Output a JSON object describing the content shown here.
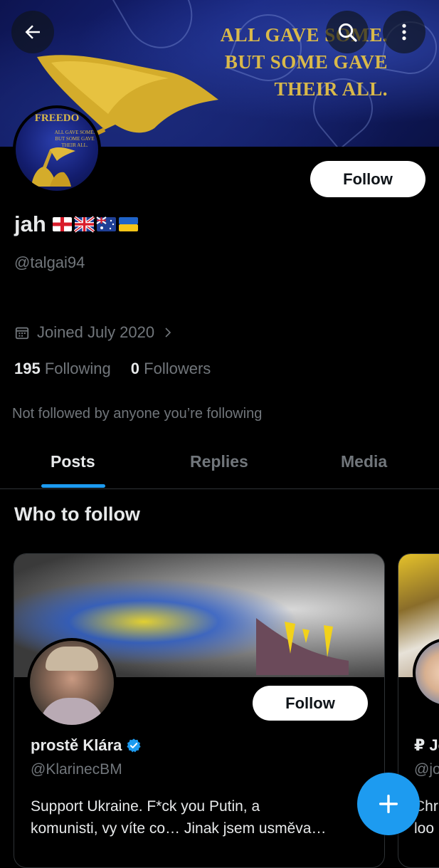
{
  "banner": {
    "text_lines": [
      "ALL GAVE SOME.",
      "BUT SOME GAVE",
      "THEIR ALL."
    ],
    "avatar_text": [
      "FREEDO",
      "ALL GAVE SOME.",
      "BUT SOME GAVE",
      "THEIR ALL."
    ]
  },
  "header": {
    "back_icon": "arrow-left-icon",
    "search_icon": "search-icon",
    "more_icon": "more-vertical-icon"
  },
  "profile": {
    "follow_label": "Follow",
    "display_name": "jah🏴󠁧󠁢󠁥󠁮󠁧󠁿🇬🇧🇦🇺🇺🇦",
    "name_text": "jah",
    "name_flags": [
      "england",
      "uk",
      "australia",
      "ukraine"
    ],
    "handle": "@talgai94",
    "joined": "Joined July 2020",
    "following_count": "195",
    "following_label": "Following",
    "followers_count": "0",
    "followers_label": "Followers",
    "not_followed_text": "Not followed by anyone you’re following"
  },
  "tabs": [
    {
      "label": "Posts",
      "active": true
    },
    {
      "label": "Replies",
      "active": false
    },
    {
      "label": "Media",
      "active": false
    }
  ],
  "who_to_follow": {
    "heading": "Who to follow",
    "cards": [
      {
        "name": "prostě Klára",
        "verified": true,
        "handle": "@KlarinecBM",
        "bio_line1": "Support Ukraine. F*ck you Putin, a",
        "bio_line2": "komunisti, vy víte co… Jinak jsem usměva…",
        "follow_label": "Follow"
      },
      {
        "name_partial": "₽ Jo",
        "handle_partial": "@jo",
        "bio_partial_line1": "Chr",
        "bio_partial_line2": "loo"
      }
    ]
  },
  "fab": {
    "icon": "plus-icon"
  },
  "colors": {
    "background": "#000000",
    "accent": "#1d9bf0",
    "secondary_text": "#71767b",
    "primary_text": "#e7e9ea",
    "banner_gold": "#d9b94a"
  }
}
